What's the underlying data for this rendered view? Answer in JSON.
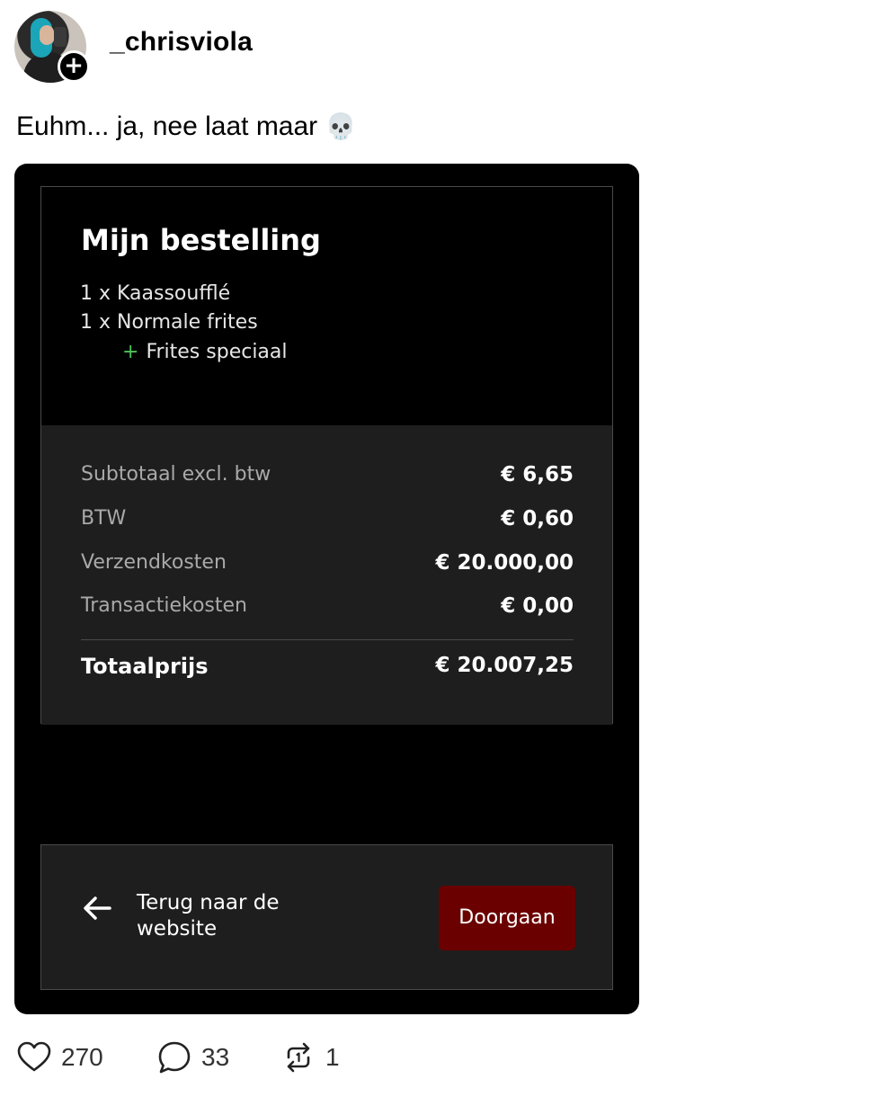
{
  "post": {
    "username": "_chrisviola",
    "caption": "Euhm... ja, nee laat maar",
    "caption_emoji": "💀"
  },
  "order": {
    "title": "Mijn bestelling",
    "items": [
      "1 x Kaassoufflé",
      "1 x Normale frites"
    ],
    "extra_prefix": "+",
    "extra": "Frites speciaal",
    "summary": {
      "subtotal_label": "Subtotaal excl. btw",
      "subtotal_value": "€ 6,65",
      "vat_label": "BTW",
      "vat_value": "€ 0,60",
      "shipping_label": "Verzendkosten",
      "shipping_value": "€ 20.000,00",
      "transaction_label": "Transactiekosten",
      "transaction_value": "€ 0,00",
      "total_label": "Totaalprijs",
      "total_value": "€ 20.007,25"
    },
    "back_label": "Terug naar de website",
    "continue_label": "Doorgaan",
    "accent_color": "#6b0000",
    "extra_color": "#4fc25a"
  },
  "actions": {
    "likes": "270",
    "replies": "33",
    "reposts": "1",
    "icons": [
      "heart-icon",
      "comment-icon",
      "repost-icon"
    ]
  }
}
